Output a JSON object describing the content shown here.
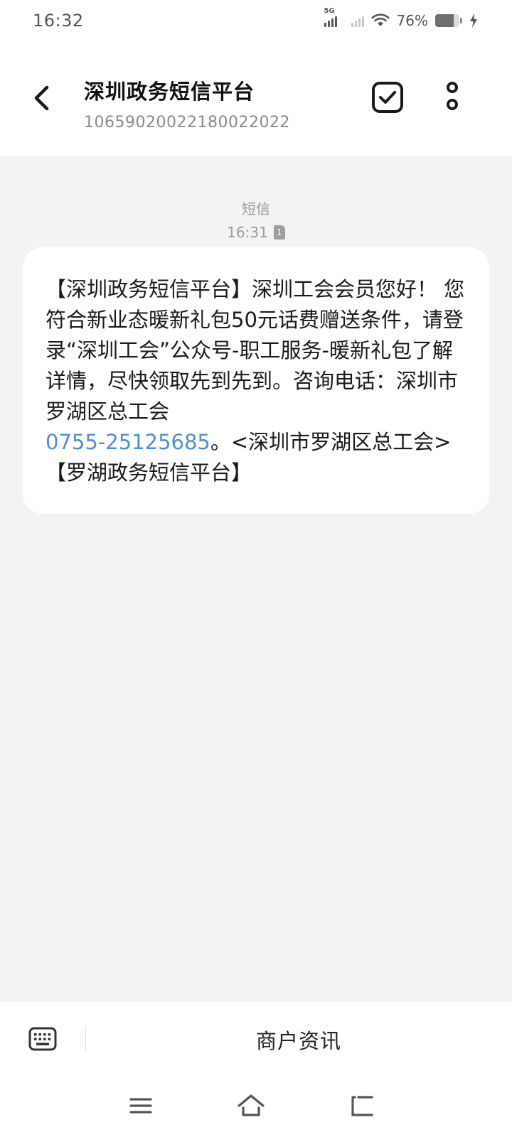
{
  "status_bar": {
    "time": "16:32",
    "network": "5G",
    "battery_percent": "76%",
    "battery_level": 0.76,
    "icons": [
      "signal-5g-icon",
      "signal-icon",
      "wifi-icon",
      "battery-icon",
      "charging-icon"
    ]
  },
  "header": {
    "title": "深圳政务短信平台",
    "number": "10659020022180022022",
    "icons": [
      "back-arrow-icon",
      "select-check-icon",
      "more-vertical-icon"
    ]
  },
  "conversation": {
    "meta_label": "短信",
    "time": "16:31",
    "sim_slot": "1",
    "message": {
      "text_before": "【深圳政务短信平台】深圳工会会员您好！ 您符合新业态暖新礼包50元话费赠送条件，请登录“深圳工会”公众号-职工服务-暖新礼包了解详情，尽快领取先到先到。咨询电话：深圳市罗湖区总工会",
      "phone": "0755-25125685",
      "text_after": "。<深圳市罗湖区总工会>【罗湖政务短信平台】"
    }
  },
  "bottom_bar": {
    "merchant_label": "商户资讯",
    "icons": [
      "keyboard-icon"
    ]
  },
  "nav_bar": {
    "icons": [
      "menu-icon",
      "home-icon",
      "back-icon"
    ]
  },
  "colors": {
    "link": "#4a90d9",
    "background": "#f3f3f3",
    "bubble": "#ffffff"
  }
}
